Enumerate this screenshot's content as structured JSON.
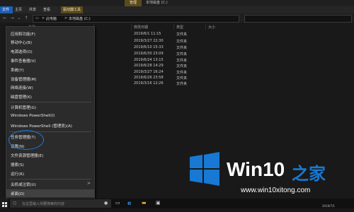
{
  "titlebar": {
    "context_tab": "管理",
    "window_title": "本地磁盘 (C:)"
  },
  "ribbon": {
    "tabs": [
      "文件",
      "主页",
      "共享",
      "查看",
      "驱动器工具"
    ]
  },
  "address": {
    "crumbs": [
      "此电脑",
      "本地磁盘 (C:)"
    ],
    "separator": ">"
  },
  "columns": {
    "name": "名称",
    "date": "修改日期",
    "type": "类型",
    "size": "大小"
  },
  "files": [
    {
      "date": "2019/6/1 11:15",
      "type": "文件夹"
    },
    {
      "date": "2019/3/27 22:30",
      "type": "文件夹"
    },
    {
      "date": "2019/6/10 15:33",
      "type": "文件夹"
    },
    {
      "date": "2019/6/30 23:09",
      "type": "文件夹"
    },
    {
      "date": "2019/6/24 13:15",
      "type": "文件夹"
    },
    {
      "date": "2019/6/28 14:29",
      "type": "文件夹"
    },
    {
      "date": "2019/3/27 16:24",
      "type": "文件夹"
    },
    {
      "date": "2019/6/26 23:58",
      "type": "文件夹"
    },
    {
      "date": "2019/3/16 12:26",
      "type": "文件夹"
    }
  ],
  "menu": {
    "items": [
      {
        "label": "应用和功能(F)"
      },
      {
        "label": "移动中心(B)"
      },
      {
        "label": "电源选项(O)"
      },
      {
        "label": "事件查看器(V)"
      },
      {
        "label": "系统(Y)"
      },
      {
        "label": "设备管理器(M)"
      },
      {
        "label": "网络连接(W)"
      },
      {
        "label": "磁盘管理(K)"
      },
      {
        "label": "计算机管理(G)"
      },
      {
        "label": "Windows PowerShell(I)"
      },
      {
        "label": "Windows PowerShell (管理员)(A)"
      },
      {
        "label": "任务管理器(T)"
      },
      {
        "label": "设置(N)"
      },
      {
        "label": "文件资源管理器(E)"
      },
      {
        "label": "搜索(S)"
      },
      {
        "label": "运行(R)"
      },
      {
        "label": "关机或注销(U)",
        "chevron": ">"
      },
      {
        "label": "桌面(D)"
      }
    ]
  },
  "taskbar": {
    "search_placeholder": "在这里输入你要搜索的内容"
  },
  "watermark": {
    "brand": "Win10",
    "brand_suffix": "之家",
    "url": "www.win10xitong.com"
  },
  "tray": {
    "date": "2019/7/1"
  },
  "colors": {
    "accent": "#1b5fb5",
    "circle": "#1e7bd6",
    "menu_bg": "#2b2b2b",
    "logo_blue": "#1779d4"
  }
}
